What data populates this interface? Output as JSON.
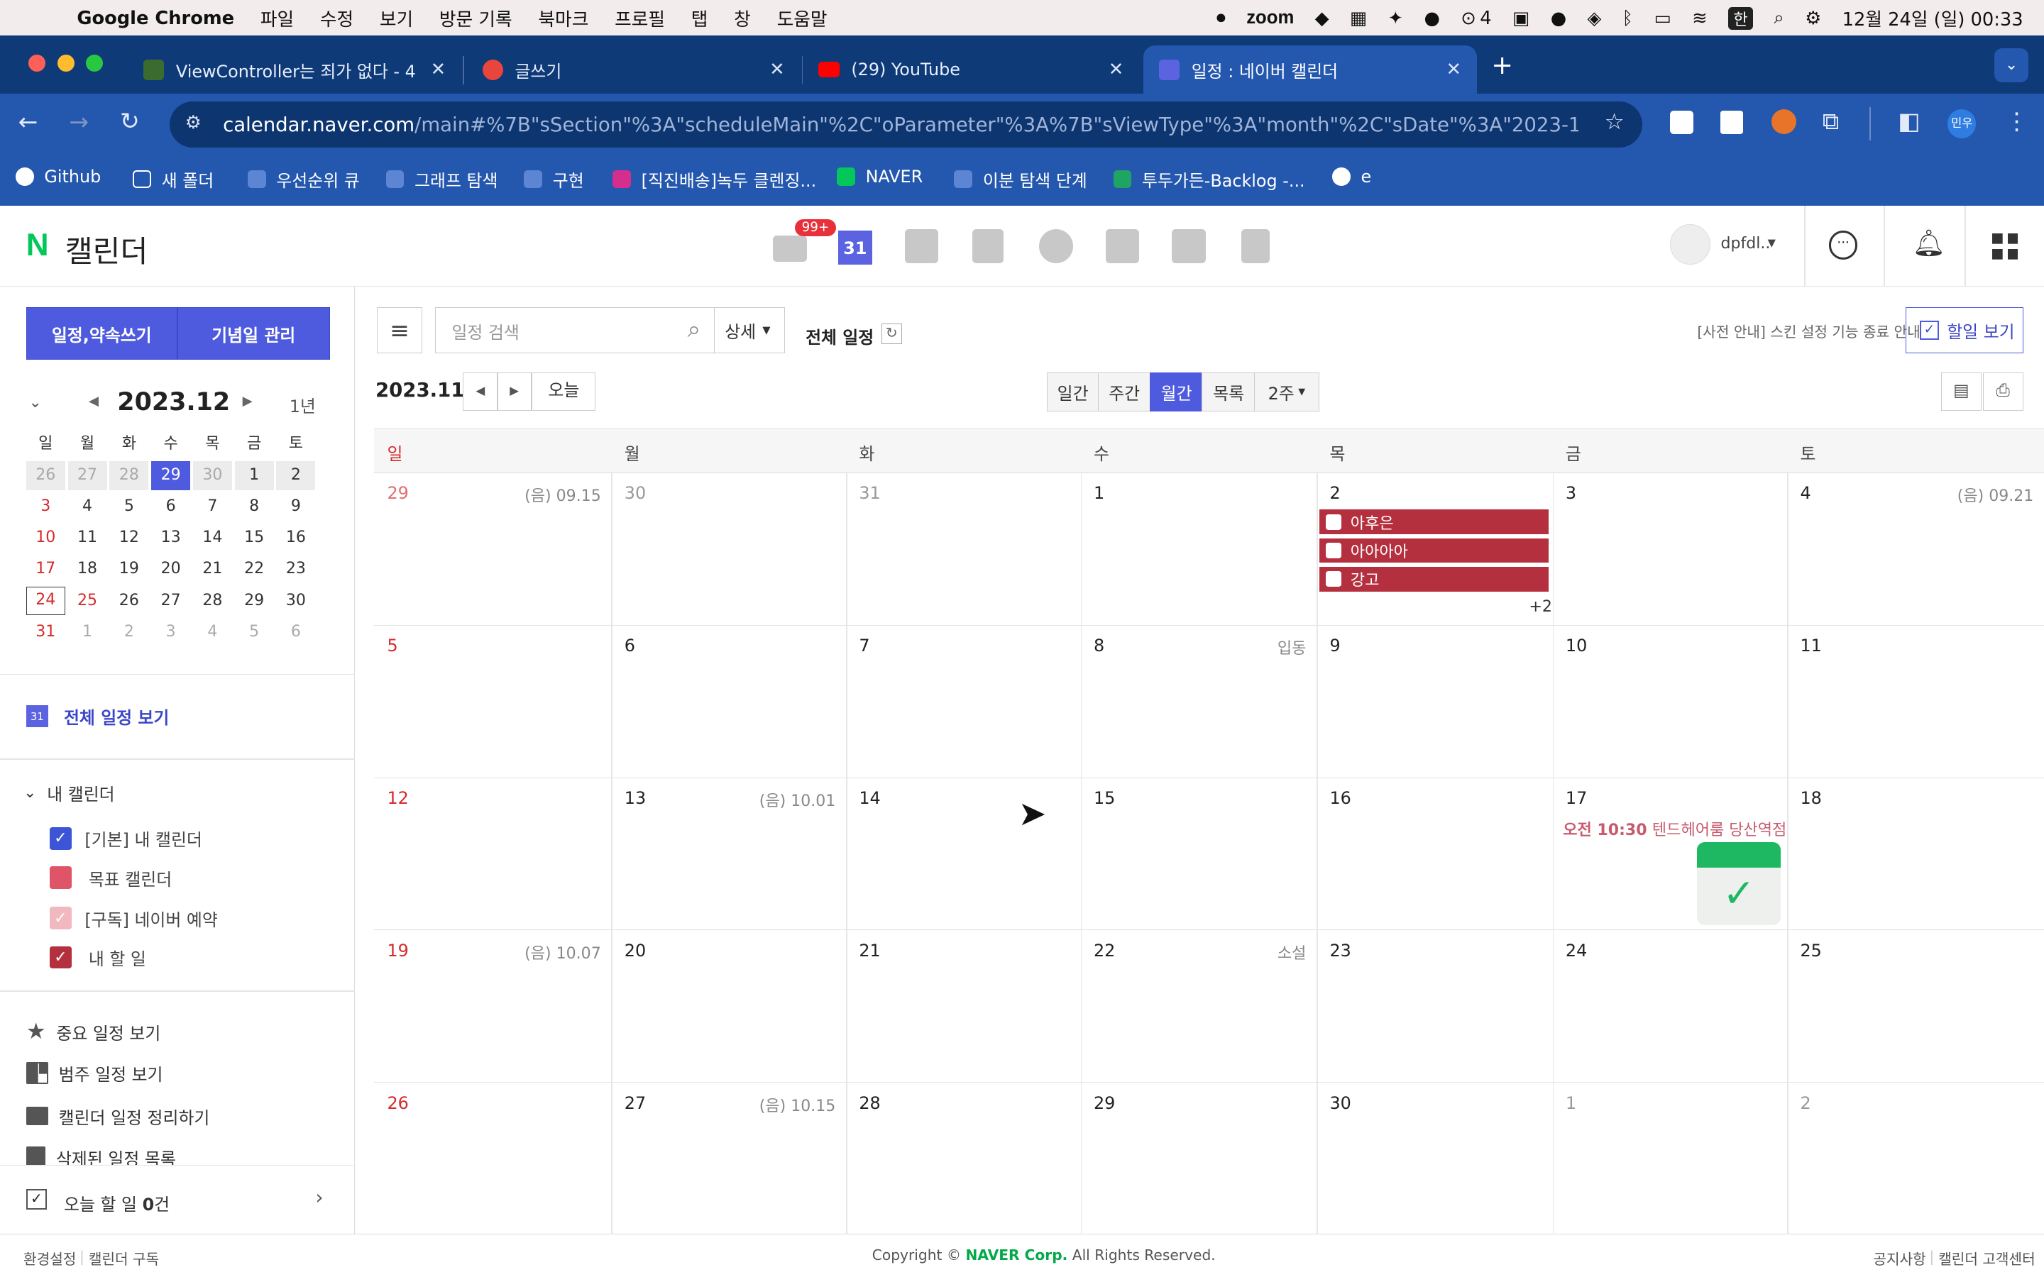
{
  "menubar": {
    "app": "Google Chrome",
    "items": [
      "파일",
      "수정",
      "보기",
      "방문 기록",
      "북마크",
      "프로필",
      "탭",
      "창",
      "도움말"
    ],
    "zoom": "zoom",
    "battery_num": "4",
    "input_lang": "한",
    "clock": "12월 24일 (일) 00:33"
  },
  "browser": {
    "tabs": [
      {
        "title": "ViewController는 죄가 없다 - 4"
      },
      {
        "title": "글쓰기"
      },
      {
        "title": "(29) YouTube"
      },
      {
        "title": "일정 : 네이버 캘린더"
      }
    ],
    "url_host": "calendar.naver.com",
    "url_rest": "/main#%7B\"sSection\"%3A\"scheduleMain\"%2C\"oParameter\"%3A%7B\"sViewType\"%3A\"month\"%2C\"sDate\"%3A\"2023-11-2...",
    "profile": "민우",
    "bookmarks": [
      "Github",
      "새 폴더",
      "우선순위 큐",
      "그래프 탐색",
      "구현",
      "[직진배송]녹두 클렌징...",
      "NAVER",
      "이분 탐색 단계",
      "투두가든-Backlog -...",
      "e"
    ]
  },
  "header": {
    "logo_n": "N",
    "logo_text": "캘린더",
    "mail_badge": "99+",
    "cal_icon_num": "31",
    "user": "dpfdl.."
  },
  "sidebar": {
    "write_btn": "일정,약속쓰기",
    "anniv_btn": "기념일 관리",
    "mini_title": "2023.12",
    "year_btn": "1년",
    "dow": [
      "일",
      "월",
      "화",
      "수",
      "목",
      "금",
      "토"
    ],
    "weeks": [
      [
        "26",
        "27",
        "28",
        "29",
        "30",
        "1",
        "2"
      ],
      [
        "3",
        "4",
        "5",
        "6",
        "7",
        "8",
        "9"
      ],
      [
        "10",
        "11",
        "12",
        "13",
        "14",
        "15",
        "16"
      ],
      [
        "17",
        "18",
        "19",
        "20",
        "21",
        "22",
        "23"
      ],
      [
        "24",
        "25",
        "26",
        "27",
        "28",
        "29",
        "30"
      ],
      [
        "31",
        "1",
        "2",
        "3",
        "4",
        "5",
        "6"
      ]
    ],
    "all_view": "전체 일정 보기",
    "all_view_icon": "31",
    "my_cal": "내 캘린더",
    "calendars": [
      {
        "label": "[기본] 내 캘린더",
        "color": "#3b55d6"
      },
      {
        "label": "목표 캘린더",
        "color": "#e05468"
      },
      {
        "label": "[구독] 네이버 예약",
        "color": "#f2b8bf"
      },
      {
        "label": "내 할 일",
        "color": "#b5303e"
      }
    ],
    "menu": [
      "중요 일정 보기",
      "범주 일정 보기",
      "캘린더 일정 정리하기",
      "삭제된 일정 목록"
    ],
    "today_todo_prefix": "오늘 할 일 ",
    "today_todo_count": "0",
    "today_todo_suffix": "건"
  },
  "main": {
    "search_placeholder": "일정 검색",
    "detail_btn": "상세",
    "all_sched": "전체 일정",
    "notice": "[사전 안내] 스킨 설정 기능 종료 안내",
    "todo_btn": "할일 보기",
    "current": "2023.11",
    "today_btn": "오늘",
    "views": [
      "일간",
      "주간",
      "월간",
      "목록",
      "2주"
    ],
    "dow": [
      "일",
      "월",
      "화",
      "수",
      "목",
      "금",
      "토"
    ],
    "weeks": [
      {
        "days": [
          "29",
          "30",
          "31",
          "1",
          "2",
          "3",
          "4"
        ],
        "lunar": [
          "(음) 09.15",
          "",
          "",
          "",
          "",
          "",
          "(음) 09.21"
        ]
      },
      {
        "days": [
          "5",
          "6",
          "7",
          "8",
          "9",
          "10",
          "11"
        ],
        "lunar": [
          "",
          "",
          "",
          "입동",
          "",
          "",
          ""
        ]
      },
      {
        "days": [
          "12",
          "13",
          "14",
          "15",
          "16",
          "17",
          "18"
        ],
        "lunar": [
          "",
          "(음) 10.01",
          "",
          "",
          "",
          "",
          ""
        ]
      },
      {
        "days": [
          "19",
          "20",
          "21",
          "22",
          "23",
          "24",
          "25"
        ],
        "lunar": [
          "(음) 10.07",
          "",
          "",
          "소설",
          "",
          "",
          ""
        ]
      },
      {
        "days": [
          "26",
          "27",
          "28",
          "29",
          "30",
          "1",
          "2"
        ],
        "lunar": [
          "",
          "(음) 10.15",
          "",
          "",
          "",
          "",
          ""
        ]
      }
    ],
    "events": [
      "아후은",
      "아아아아",
      "강고"
    ],
    "more": "+2",
    "timed_event_time": "오전 10:30",
    "timed_event_title": "텐드헤어룸 당산역점"
  },
  "footer": {
    "settings": "환경설정",
    "subscribe": "캘린더 구독",
    "copyright_pre": "Copyright © ",
    "copyright_brand": "NAVER Corp.",
    "copyright_post": " All Rights Reserved.",
    "notice": "공지사항",
    "support": "캘린더 고객센터"
  }
}
